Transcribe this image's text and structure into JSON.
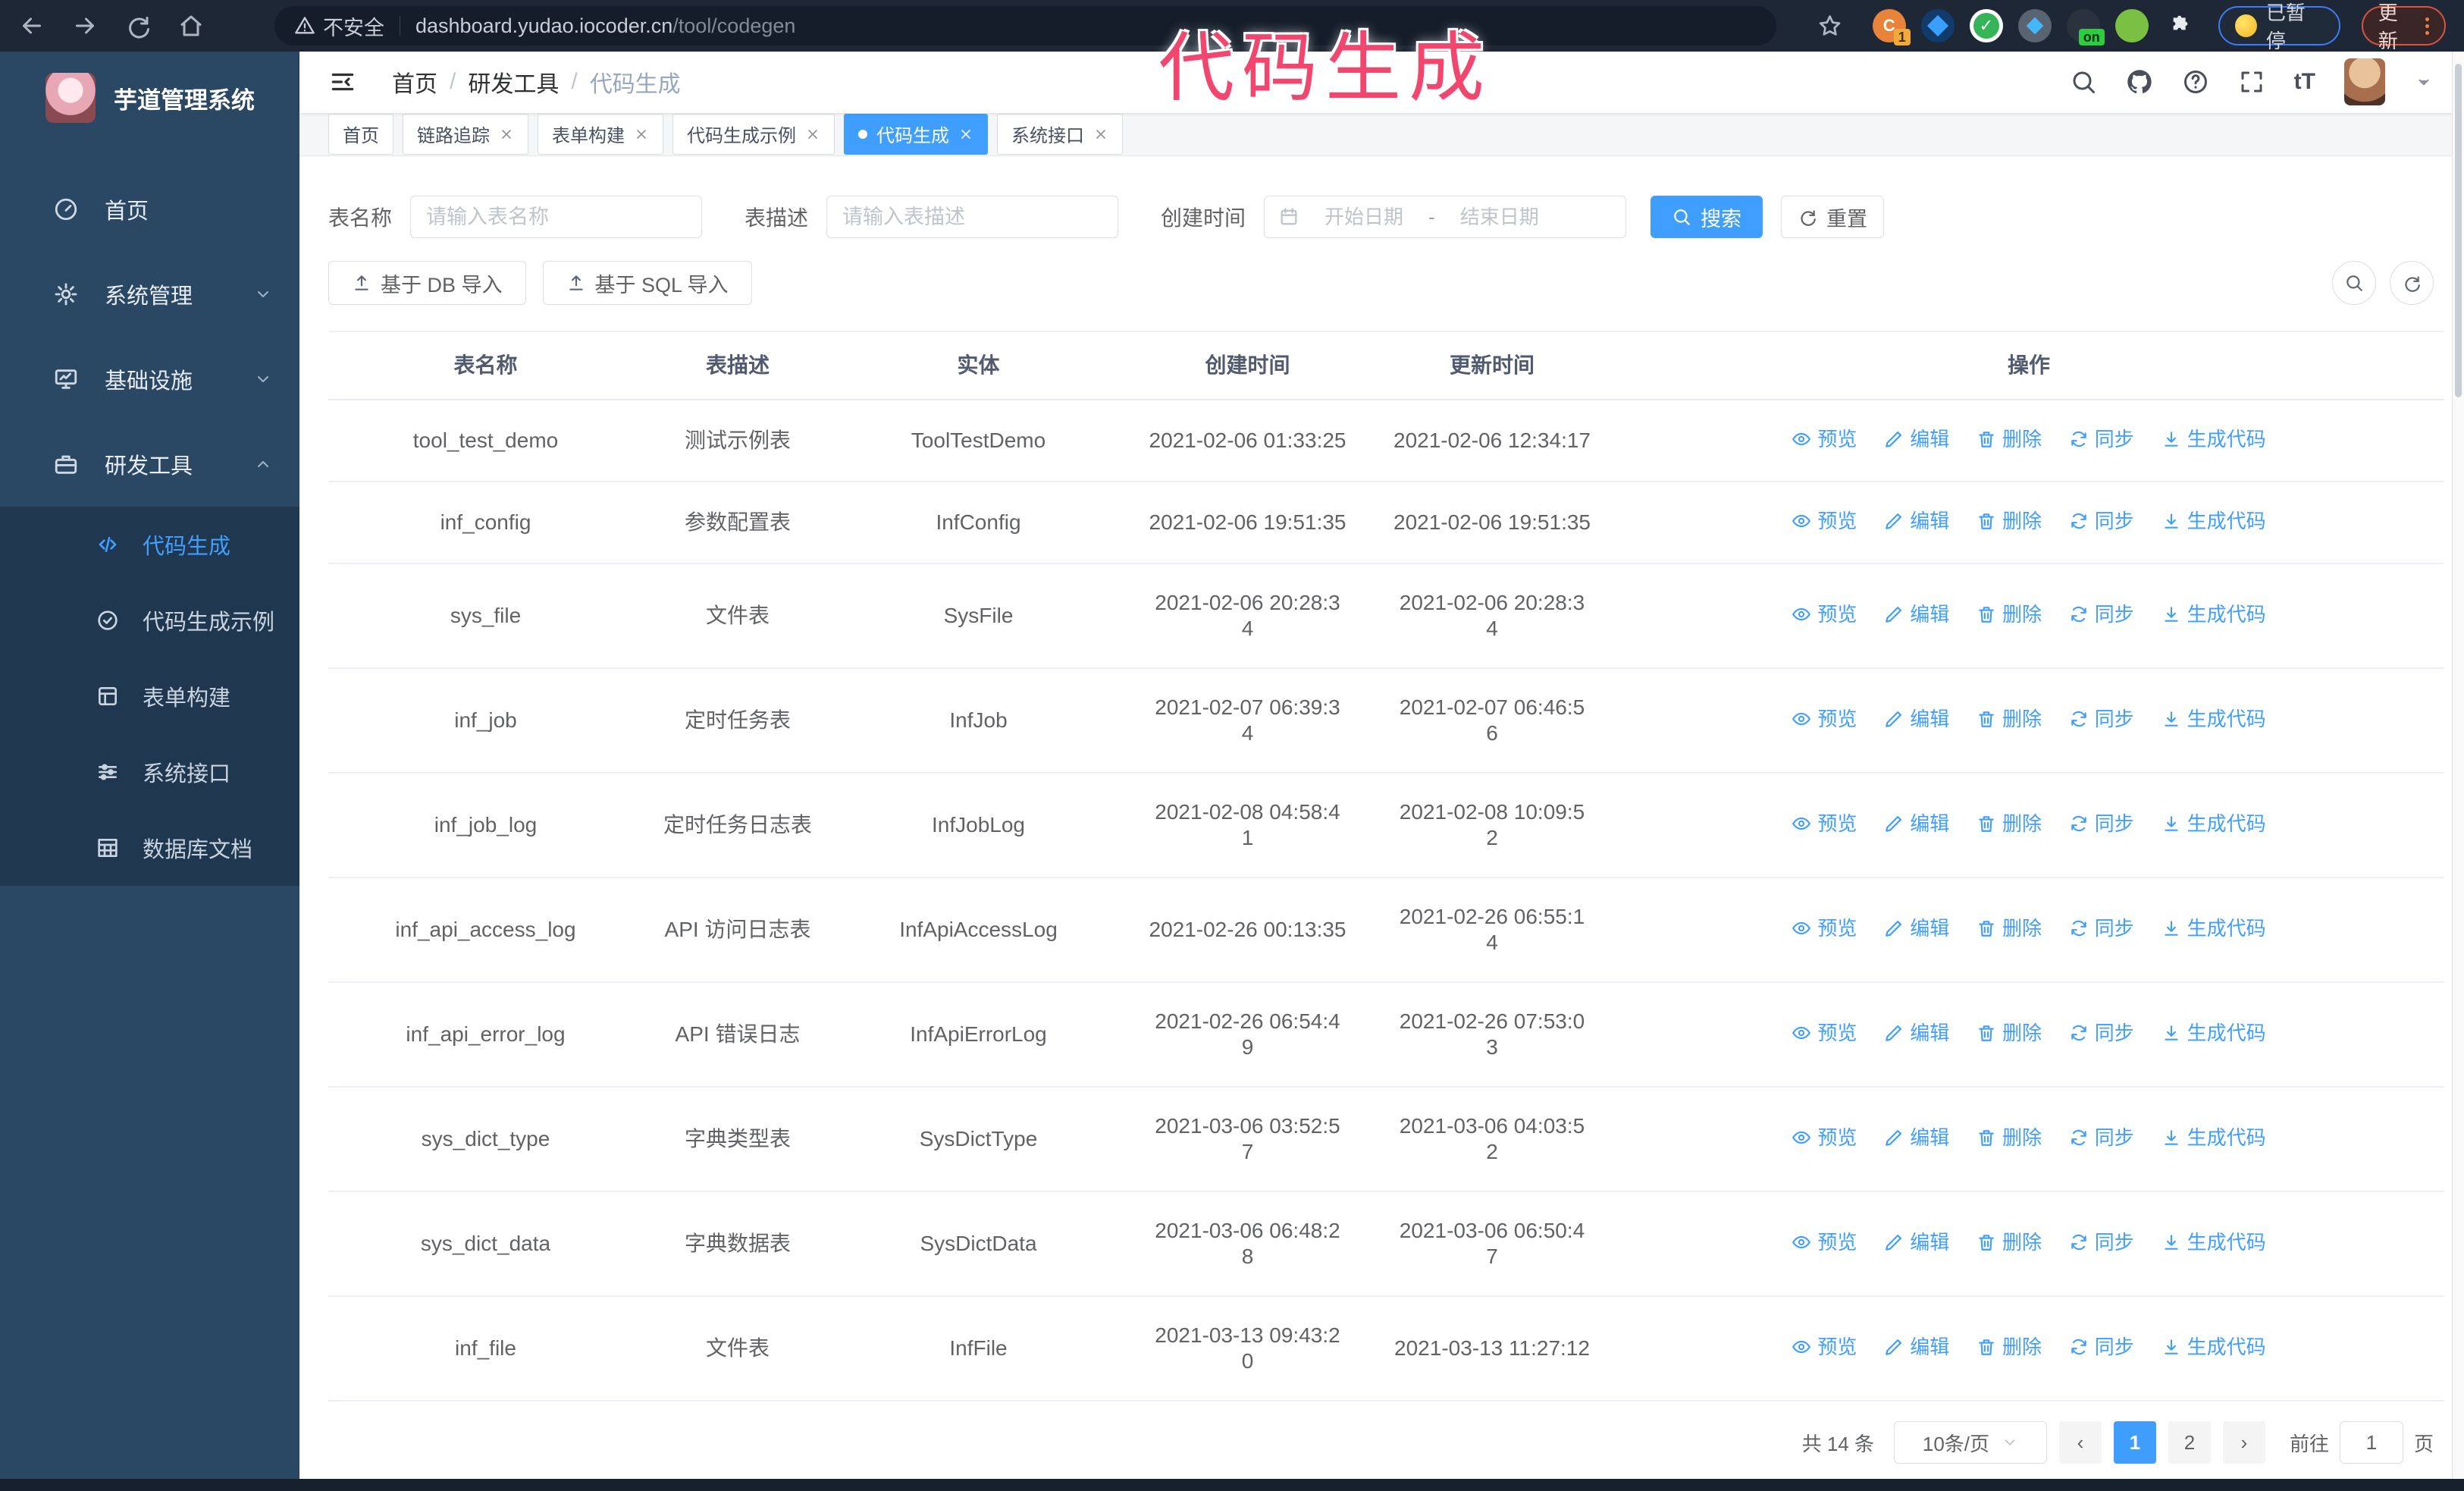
{
  "browser": {
    "security_label": "不安全",
    "url_host": "dashboard.yudao.iocoder.cn",
    "url_path": "/tool/codegen",
    "extension_badge": "1",
    "on_badge": "on",
    "paused_label": "已暂停",
    "update_label": "更新"
  },
  "overlay_title": "代码生成",
  "sidebar": {
    "app_title": "芋道管理系统",
    "items": [
      {
        "label": "首页",
        "icon": "dashboard-icon"
      },
      {
        "label": "系统管理",
        "icon": "gear-icon",
        "chevron": "down"
      },
      {
        "label": "基础设施",
        "icon": "infrastructure-icon",
        "chevron": "down"
      },
      {
        "label": "研发工具",
        "icon": "dev-tools-icon",
        "chevron": "up"
      }
    ],
    "submenu": [
      {
        "label": "代码生成",
        "icon": "code-icon",
        "active": true
      },
      {
        "label": "代码生成示例",
        "icon": "example-icon"
      },
      {
        "label": "表单构建",
        "icon": "form-builder-icon"
      },
      {
        "label": "系统接口",
        "icon": "api-icon"
      },
      {
        "label": "数据库文档",
        "icon": "database-doc-icon"
      }
    ]
  },
  "breadcrumb": [
    "首页",
    "研发工具",
    "代码生成"
  ],
  "tabs": [
    {
      "label": "首页"
    },
    {
      "label": "链路追踪",
      "closable": true
    },
    {
      "label": "表单构建",
      "closable": true
    },
    {
      "label": "代码生成示例",
      "closable": true
    },
    {
      "label": "代码生成",
      "closable": true,
      "active": true
    },
    {
      "label": "系统接口",
      "closable": true
    }
  ],
  "filter": {
    "name_label": "表名称",
    "name_placeholder": "请输入表名称",
    "desc_label": "表描述",
    "desc_placeholder": "请输入表描述",
    "time_label": "创建时间",
    "start_placeholder": "开始日期",
    "range_separator": "-",
    "end_placeholder": "结束日期",
    "search_label": "搜索",
    "reset_label": "重置"
  },
  "toolbar": {
    "import_db_label": "基于 DB 导入",
    "import_sql_label": "基于 SQL 导入"
  },
  "table": {
    "columns": [
      "表名称",
      "表描述",
      "实体",
      "创建时间",
      "更新时间",
      "操作"
    ],
    "action_labels": {
      "preview": "预览",
      "edit": "编辑",
      "delete": "删除",
      "sync": "同步",
      "generate": "生成代码"
    },
    "rows": [
      {
        "name": "tool_test_demo",
        "desc": "测试示例表",
        "entity": "ToolTestDemo",
        "created": "2021-02-06 01:33:25",
        "updated": "2021-02-06 12:34:17"
      },
      {
        "name": "inf_config",
        "desc": "参数配置表",
        "entity": "InfConfig",
        "created": "2021-02-06 19:51:35",
        "updated": "2021-02-06 19:51:35"
      },
      {
        "name": "sys_file",
        "desc": "文件表",
        "entity": "SysFile",
        "created": "2021-02-06 20:28:3\n4",
        "updated": "2021-02-06 20:28:3\n4"
      },
      {
        "name": "inf_job",
        "desc": "定时任务表",
        "entity": "InfJob",
        "created": "2021-02-07 06:39:3\n4",
        "updated": "2021-02-07 06:46:5\n6"
      },
      {
        "name": "inf_job_log",
        "desc": "定时任务日志表",
        "entity": "InfJobLog",
        "created": "2021-02-08 04:58:4\n1",
        "updated": "2021-02-08 10:09:5\n2"
      },
      {
        "name": "inf_api_access_log",
        "desc": "API 访问日志表",
        "entity": "InfApiAccessLog",
        "created": "2021-02-26 00:13:35",
        "updated": "2021-02-26 06:55:1\n4"
      },
      {
        "name": "inf_api_error_log",
        "desc": "API 错误日志",
        "entity": "InfApiErrorLog",
        "created": "2021-02-26 06:54:4\n9",
        "updated": "2021-02-26 07:53:0\n3"
      },
      {
        "name": "sys_dict_type",
        "desc": "字典类型表",
        "entity": "SysDictType",
        "created": "2021-03-06 03:52:5\n7",
        "updated": "2021-03-06 04:03:5\n2"
      },
      {
        "name": "sys_dict_data",
        "desc": "字典数据表",
        "entity": "SysDictData",
        "created": "2021-03-06 06:48:2\n8",
        "updated": "2021-03-06 06:50:4\n7"
      },
      {
        "name": "inf_file",
        "desc": "文件表",
        "entity": "InfFile",
        "created": "2021-03-13 09:43:2\n0",
        "updated": "2021-03-13 11:27:12"
      }
    ]
  },
  "pagination": {
    "total_label": "共 14 条",
    "page_size_label": "10条/页",
    "pages": [
      "1",
      "2"
    ],
    "active_page": "1",
    "goto_label": "前往",
    "goto_value": "1",
    "page_unit": "页"
  },
  "colors": {
    "accent": "#409eff",
    "overlay_pink": "#f2466e",
    "sidebar_bg": "#2a4864",
    "submenu_bg": "#1f3850",
    "browser_bar": "#1d2735"
  }
}
